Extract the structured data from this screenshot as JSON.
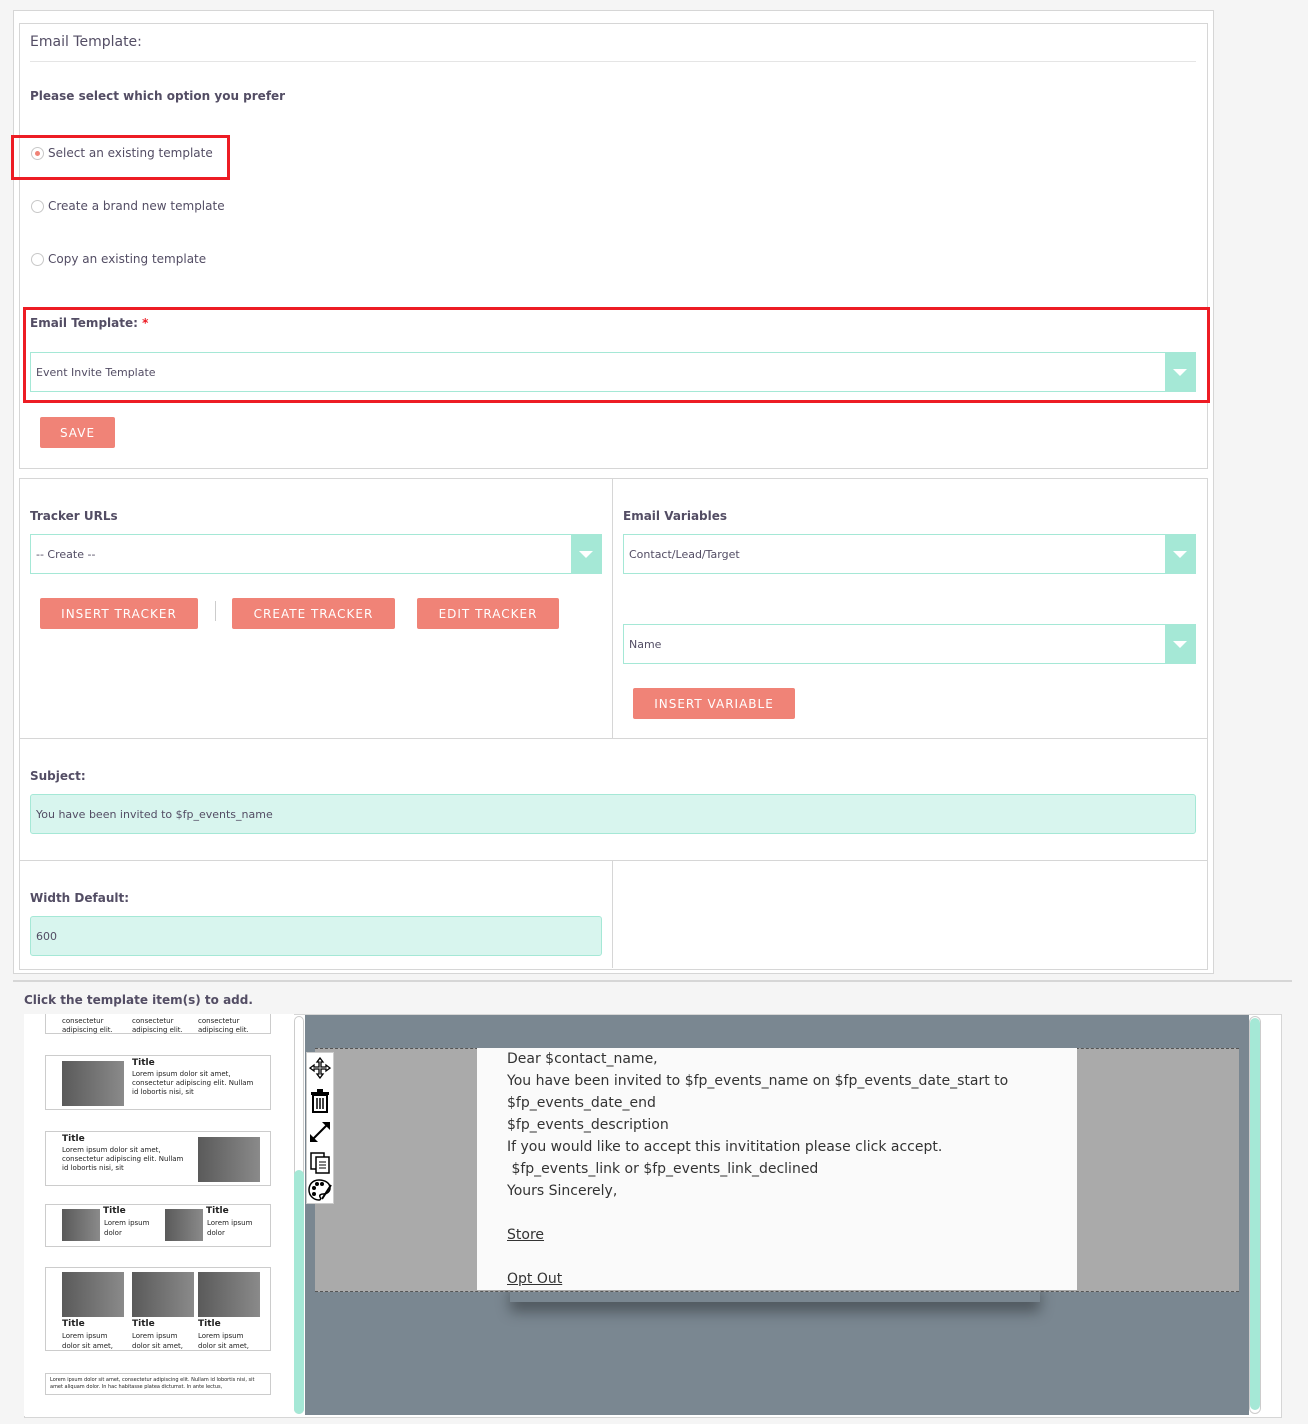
{
  "section_title": "Email Template:",
  "prompt": "Please select which option you prefer",
  "options": [
    {
      "label": "Select an existing template",
      "checked": true
    },
    {
      "label": "Create a brand new template",
      "checked": false
    },
    {
      "label": "Copy an existing template",
      "checked": false
    }
  ],
  "email_template": {
    "label": "Email Template:",
    "required_mark": "*",
    "value": "Event Invite Template"
  },
  "save_label": "SAVE",
  "tracker": {
    "label": "Tracker URLs",
    "value": "-- Create --",
    "insert_label": "INSERT TRACKER",
    "create_label": "CREATE TRACKER",
    "edit_label": "EDIT TRACKER"
  },
  "variables": {
    "label": "Email Variables",
    "module_value": "Contact/Lead/Target",
    "field_value": "Name",
    "insert_label": "INSERT VARIABLE"
  },
  "subject": {
    "label": "Subject:",
    "value": "You have been invited to $fp_events_name"
  },
  "width_default": {
    "label": "Width Default:",
    "value": "600"
  },
  "editor_hint": "Click the template item(s) to add.",
  "thumbnails": {
    "top_partial": [
      "consectetur adipiscing elit.",
      "consectetur adipiscing elit.",
      "consectetur adipiscing elit."
    ],
    "title": "Title",
    "body_long": "Lorem ipsum dolor sit amet, consectetur adipiscing elit. Nullam id lobortis nisi, sit",
    "body_short": "Lorem ipsum dolor",
    "body_mid": "Lorem ipsum dolor sit amet,",
    "footer_text": "Lorem ipsum dolor sit amet, consectetur adipiscing elit. Nullam id lobortis nisi, sit amet aliquam dolor. In hac habitasse platea dictumst. In ante lectus,"
  },
  "email_body": {
    "lines": [
      "Dear $contact_name,",
      "You have been invited to $fp_events_name on $fp_events_date_start to",
      "$fp_events_date_end",
      "$fp_events_description",
      "If you would like to accept this invititation please click accept.",
      " $fp_events_link or $fp_events_link_declined",
      "Yours Sincerely,"
    ],
    "store_link": "Store",
    "optout_link": "Opt Out"
  },
  "colors": {
    "accent": "#f08377",
    "field_border": "#a5e8d6",
    "field_fill": "#d8f5ee",
    "highlight": "#ed1c24"
  },
  "toolbar_icons": [
    "move-icon",
    "trash-icon",
    "resize-icon",
    "duplicate-icon",
    "palette-icon"
  ]
}
